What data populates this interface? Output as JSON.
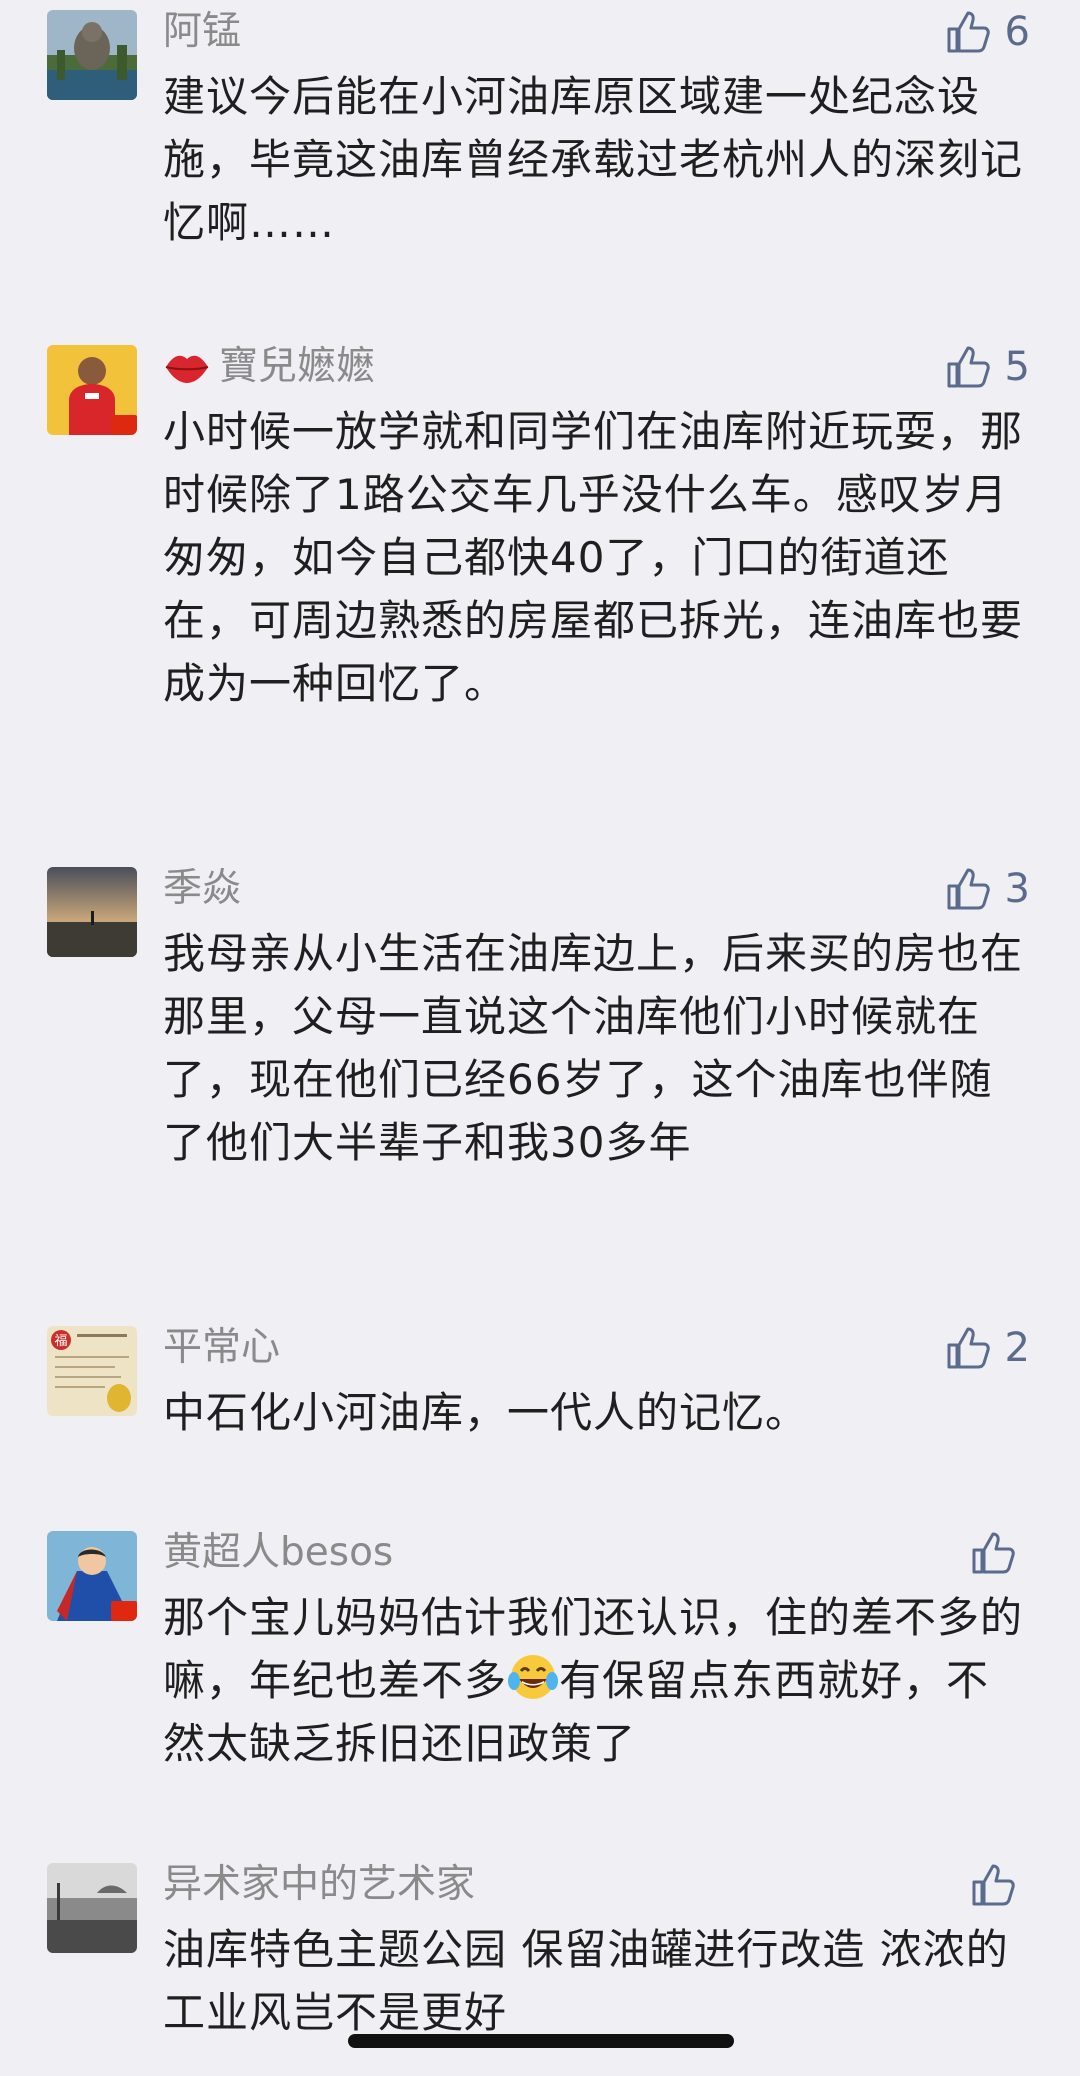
{
  "comments": [
    {
      "author": "阿锰",
      "likes": "6",
      "text": "建议今后能在小河油库原区域建一处纪念设施，毕竟这油库曾经承载过老杭州人的深刻记忆啊……",
      "avatar_icon": "statue-landscape-photo"
    },
    {
      "author": "寶兒嬷嬷",
      "likes": "5",
      "text": "小时候一放学就和同学们在油库附近玩耍，那时候除了1路公交车几乎没什么车。感叹岁月匆匆，如今自己都快40了，门口的街道还在，可周边熟悉的房屋都已拆光，连油库也要成为一种回忆了。",
      "avatar_icon": "child-red-shirt-photo",
      "name_prefix_icon": "lips-icon"
    },
    {
      "author": "季焱",
      "likes": "3",
      "text": "我母亲从小生活在油库边上，后来买的房也在那里，父母一直说这个油库他们小时候就在了，现在他们已经66岁了，这个油库也伴随了他们大半辈子和我30多年",
      "avatar_icon": "beach-sunset-photo"
    },
    {
      "author": "平常心",
      "likes": "2",
      "text": "中石化小河油库，一代人的记忆。",
      "avatar_icon": "fu-calligraphy-card"
    },
    {
      "author": "黄超人besos",
      "likes": "",
      "text_before_emoji": "那个宝儿妈妈估计我们还认识，住的差不多的嘛，年纪也差不多",
      "emoji": "tears-of-joy-emoji",
      "text_after_emoji": "有保留点东西就好，不然太缺乏拆旧还旧政策了",
      "avatar_icon": "superman-cartoon-photo"
    },
    {
      "author": "异术家中的艺术家",
      "likes": "",
      "text": "油库特色主题公园 保留油罐进行改造 浓浓的工业风岂不是更好",
      "avatar_icon": "street-wall-photo"
    }
  ],
  "colors": {
    "background": "#efeff4",
    "name": "#8a8a8a",
    "text": "#1f1f1f",
    "like": "#5b6b8c"
  }
}
